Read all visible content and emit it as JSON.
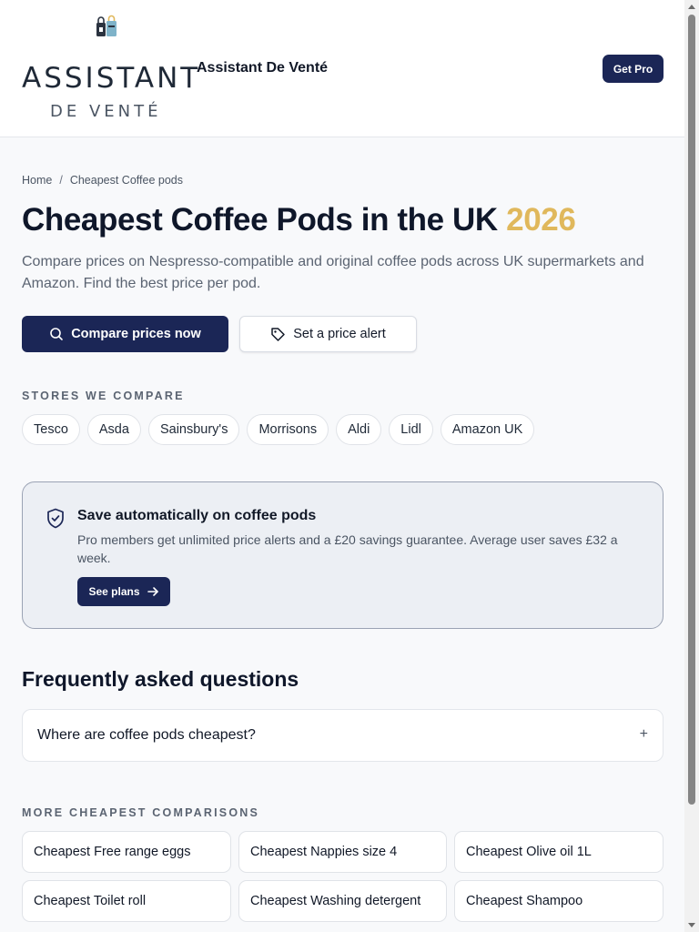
{
  "header": {
    "logo_word": "ASSISTANT",
    "logo_sub": "DE VENTÉ",
    "brand_name": "Assistant De Venté",
    "cta_label": "Get Pro"
  },
  "breadcrumb": {
    "home": "Home",
    "separator": "/",
    "current": "Cheapest Coffee pods"
  },
  "hero": {
    "title": "Cheapest Coffee Pods in the UK",
    "year": "2026",
    "year_color": "#e0b85c",
    "subtitle": "Compare prices on Nespresso-compatible and original coffee pods across UK supermarkets and Amazon. Find the best price per pod.",
    "primary_button": "Compare prices now",
    "secondary_button": "Set a price alert"
  },
  "stores": {
    "label": "STORES WE COMPARE",
    "items": [
      "Tesco",
      "Asda",
      "Sainsbury's",
      "Morrisons",
      "Aldi",
      "Lidl",
      "Amazon UK"
    ]
  },
  "promo": {
    "title": "Save automatically on coffee pods",
    "text": "Pro members get unlimited price alerts and a £20 savings guarantee. Average user saves £32 a week.",
    "button": "See plans"
  },
  "faq": {
    "title": "Frequently asked questions",
    "items": [
      {
        "question": "Where are coffee pods cheapest?",
        "toggle": "+"
      }
    ]
  },
  "more": {
    "label": "MORE CHEAPEST COMPARISONS",
    "items": [
      "Cheapest Free range eggs",
      "Cheapest Nappies size 4",
      "Cheapest Olive oil 1L",
      "Cheapest Toilet roll",
      "Cheapest Washing detergent",
      "Cheapest Shampoo"
    ]
  },
  "colors": {
    "brand_navy": "#1b2656",
    "accent_gold": "#e0b85c"
  }
}
